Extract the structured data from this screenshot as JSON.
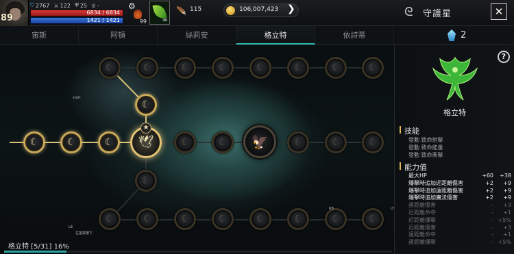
{
  "player": {
    "level": "89",
    "power": "2767",
    "stat_a": "122",
    "stat_b": "25",
    "stat_c": "-",
    "hp_text": "6834 / 6834",
    "hp_ratio": 1.0,
    "mp_text": "1421 / 1421",
    "mp_ratio": 1.0
  },
  "slots": {
    "potion_count": "99",
    "leaf_count": "∞"
  },
  "currency": {
    "wings": "115",
    "gold": "106,007,423"
  },
  "page": {
    "title": "守護星",
    "logo": "ᘓ",
    "close": "✕"
  },
  "tabs": [
    {
      "label": "宙斯",
      "active": false
    },
    {
      "label": "阿頓",
      "active": false
    },
    {
      "label": "絲莉安",
      "active": false
    },
    {
      "label": "格立特",
      "active": true
    },
    {
      "label": "依詩蒂",
      "active": false
    }
  ],
  "crystals": "2",
  "graph": {
    "start_label": "start",
    "small_labels": [
      "L8",
      "RB",
      "LT",
      "RT"
    ],
    "sub_label": "左搖桿按下",
    "star": "★"
  },
  "progress": {
    "label": "格立特 [5/31] 16%",
    "ratio": 0.16
  },
  "panel": {
    "help": "?",
    "name": "格立特",
    "skill_title": "技能",
    "skills": [
      "發動 致命射擊",
      "發動 致命能量",
      "發動 致命衝擊"
    ],
    "ability_title": "能力值",
    "stats": [
      {
        "name": "最大HP",
        "a": "+60",
        "b": "+38",
        "on": true
      },
      {
        "name": "爆擊時追加近距離傷害",
        "a": "+2",
        "b": "+9",
        "on": true
      },
      {
        "name": "爆擊時追加遠距離傷害",
        "a": "+2",
        "b": "+9",
        "on": true
      },
      {
        "name": "爆擊時追加魔法傷害",
        "a": "+2",
        "b": "+9",
        "on": true
      },
      {
        "name": "遠距離傷害",
        "a": "-",
        "b": "+3",
        "on": false
      },
      {
        "name": "近距離命中",
        "a": "-",
        "b": "+1",
        "on": false
      },
      {
        "name": "近距離爆擊",
        "a": "-",
        "b": "+5%",
        "on": false
      },
      {
        "name": "近距離傷害",
        "a": "-",
        "b": "+3",
        "on": false
      },
      {
        "name": "遠距離命中",
        "a": "-",
        "b": "+1",
        "on": false
      },
      {
        "name": "遠距離爆擊",
        "a": "-",
        "b": "+5%",
        "on": false
      }
    ]
  },
  "colors": {
    "accent": "#2aa7a0",
    "lit_path": "#d8c07a",
    "hp": "#c62a2a",
    "mp": "#2a5cc6"
  }
}
